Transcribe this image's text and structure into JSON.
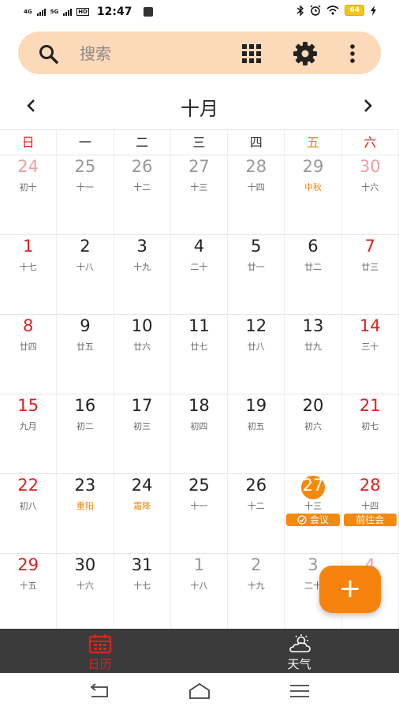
{
  "status_bar": {
    "net1": "4G",
    "net2": "5G",
    "hd": "HD",
    "time": "12:47",
    "battery": "64"
  },
  "search": {
    "placeholder": "搜索"
  },
  "header": {
    "month": "十月"
  },
  "weekdays": [
    "日",
    "一",
    "二",
    "三",
    "四",
    "五",
    "六"
  ],
  "weeks": [
    [
      {
        "day": "24",
        "lunar": "初十"
      },
      {
        "day": "25",
        "lunar": "十一"
      },
      {
        "day": "26",
        "lunar": "十二"
      },
      {
        "day": "27",
        "lunar": "十三"
      },
      {
        "day": "28",
        "lunar": "十四"
      },
      {
        "day": "29",
        "lunar": "中秋"
      },
      {
        "day": "30",
        "lunar": "十六"
      }
    ],
    [
      {
        "day": "1",
        "lunar": "十七"
      },
      {
        "day": "2",
        "lunar": "十八"
      },
      {
        "day": "3",
        "lunar": "十九"
      },
      {
        "day": "4",
        "lunar": "二十"
      },
      {
        "day": "5",
        "lunar": "廿一"
      },
      {
        "day": "6",
        "lunar": "廿二"
      },
      {
        "day": "7",
        "lunar": "廿三"
      }
    ],
    [
      {
        "day": "8",
        "lunar": "廿四"
      },
      {
        "day": "9",
        "lunar": "廿五"
      },
      {
        "day": "10",
        "lunar": "廿六"
      },
      {
        "day": "11",
        "lunar": "廿七"
      },
      {
        "day": "12",
        "lunar": "廿八"
      },
      {
        "day": "13",
        "lunar": "廿九"
      },
      {
        "day": "14",
        "lunar": "三十"
      }
    ],
    [
      {
        "day": "15",
        "lunar": "九月"
      },
      {
        "day": "16",
        "lunar": "初二"
      },
      {
        "day": "17",
        "lunar": "初三"
      },
      {
        "day": "18",
        "lunar": "初四"
      },
      {
        "day": "19",
        "lunar": "初五"
      },
      {
        "day": "20",
        "lunar": "初六"
      },
      {
        "day": "21",
        "lunar": "初七"
      }
    ],
    [
      {
        "day": "22",
        "lunar": "初八"
      },
      {
        "day": "23",
        "lunar": "重阳"
      },
      {
        "day": "24",
        "lunar": "霜降"
      },
      {
        "day": "25",
        "lunar": "十一"
      },
      {
        "day": "26",
        "lunar": "十二"
      },
      {
        "day": "27",
        "lunar": "十三",
        "event": "会议"
      },
      {
        "day": "28",
        "lunar": "十四",
        "event": "前往会"
      }
    ],
    [
      {
        "day": "29",
        "lunar": "十五"
      },
      {
        "day": "30",
        "lunar": "十六"
      },
      {
        "day": "31",
        "lunar": "十七"
      },
      {
        "day": "1",
        "lunar": "十八"
      },
      {
        "day": "2",
        "lunar": "十九"
      },
      {
        "day": "3",
        "lunar": "二十"
      },
      {
        "day": "4",
        "lunar": "廿二"
      }
    ]
  ],
  "tabs": {
    "calendar": "日历",
    "weather": "天气"
  },
  "colors": {
    "accent": "#f5890f",
    "weekend_red": "#e02020",
    "search_bg": "#fcd9b8",
    "tabbar_bg": "#3b3b3b"
  }
}
